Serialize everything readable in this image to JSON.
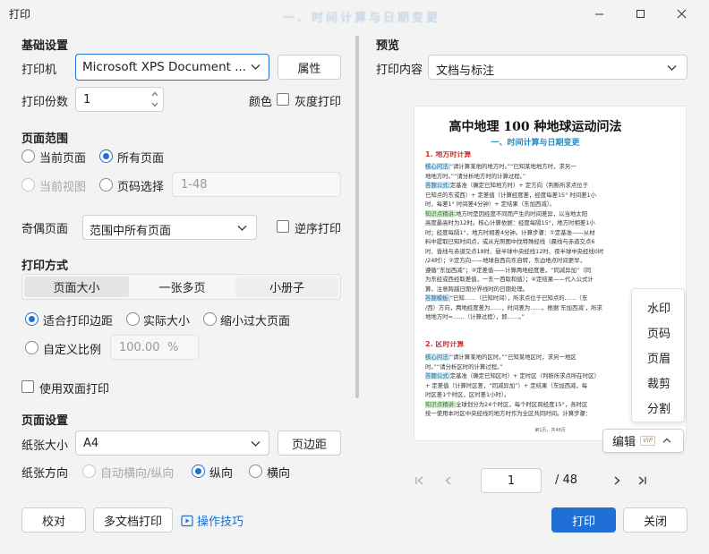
{
  "window": {
    "title": "打印",
    "faded_header": "一、时间计算与日期变更"
  },
  "basic": {
    "title": "基础设置",
    "printer_label": "打印机",
    "printer_value": "Microsoft XPS Document ...",
    "properties_button": "属性",
    "copies_label": "打印份数",
    "copies_value": "1",
    "color_label": "颜色",
    "grayscale_label": "灰度打印"
  },
  "range": {
    "title": "页面范围",
    "current_page": "当前页面",
    "all_pages": "所有页面",
    "current_view": "当前视图",
    "page_select": "页码选择",
    "page_select_placeholder": "1-48",
    "odd_even_label": "奇偶页面",
    "odd_even_value": "范围中所有页面",
    "reverse_label": "逆序打印"
  },
  "mode": {
    "title": "打印方式",
    "tabs": [
      "页面大小",
      "一张多页",
      "小册子"
    ],
    "fit_margins": "适合打印边距",
    "actual_size": "实际大小",
    "shrink_large": "缩小过大页面",
    "custom_scale": "自定义比例",
    "scale_value": "100.00",
    "scale_unit": "%",
    "duplex_label": "使用双面打印"
  },
  "page_setup": {
    "title": "页面设置",
    "paper_size_label": "纸张大小",
    "paper_size_value": "A4",
    "margins_button": "页边距",
    "orientation_label": "纸张方向",
    "auto_orientation": "自动横向/纵向",
    "portrait": "纵向",
    "landscape": "横向"
  },
  "footer": {
    "proofread_button": "校对",
    "multi_doc_button": "多文档打印",
    "tips_link": "操作技巧",
    "print_button": "打印",
    "close_button": "关闭"
  },
  "preview": {
    "title": "预览",
    "content_label": "打印内容",
    "content_value": "文档与标注",
    "edit_button": "编辑",
    "vip_badge": "VIP",
    "current_page": "1",
    "total_pages": "/ 48",
    "menu_items": [
      "水印",
      "页码",
      "页眉",
      "裁剪",
      "分割"
    ],
    "doc": {
      "title": "高中地理 100 种地球运动问法",
      "subtitle": "一、时间计算与日期变更",
      "h1": "1. 地方时计算",
      "lines": [
        {
          "tag": "核心问法:",
          "text": "“请计算某地的地方时。”“已知某地地方时，求另一"
        },
        {
          "tag": "",
          "text": "地地方时。”“请分析地方时的计算过程。”"
        },
        {
          "tag": "答题公式:",
          "text": "定基准（确定已知地方时）+ 定方向（判断所求点位于"
        },
        {
          "tag": "",
          "text": "已知点的东或西）+ 定差值（计算经度差，经度每差15° 时间差1小"
        },
        {
          "tag": "",
          "text": "时，每差1° 时间差4分钟）+ 定结果（东加西减）。"
        },
        {
          "tag": "知识点精讲:",
          "text": "地方时是因经度不同而产生的时间差异，以当地太阳"
        },
        {
          "tag": "",
          "text": "高度最高时为12时。核心计算依据：经度每隔15°，地方时相差1小"
        },
        {
          "tag": "",
          "text": "时；经度每隔1°，地方时相差4分钟。计算步骤：①定基准——从材"
        },
        {
          "tag": "",
          "text": "料中提取已知时间点，或从光照图中找特殊经线（晨线与赤道交点6"
        },
        {
          "tag": "",
          "text": "时、昏线与赤道交点18时、昼半球中央经线12时、夜半球中央经线0时"
        },
        {
          "tag": "",
          "text": "/24时）；②定方向——地球自西向东自转，东边地点时间更早，"
        },
        {
          "tag": "",
          "text": "遵循“东加西减”；③定差值——计算两地经度差，“同减异加”（同"
        },
        {
          "tag": "",
          "text": "为东经或西经取差值，一东一西取和值）；④定结果——代入公式计"
        },
        {
          "tag": "",
          "text": "算，注意跨越日期分界线时的日期处理。"
        },
        {
          "tag": "答题模板:",
          "text": "“已知……（已知时间），所求点位于已知点的……（东"
        },
        {
          "tag": "",
          "text": "/西）方向，两地经度差为……，时间差为……。根据‘东加西减’，所求"
        },
        {
          "tag": "",
          "text": "地地方时=……（计算过程），即……。”"
        }
      ],
      "h2": "2. 区时计算",
      "lines2": [
        {
          "tag": "核心问法:",
          "text": "“请计算某地的区时。”“已知某地区时，求另一地区"
        },
        {
          "tag": "",
          "text": "时。”“请分析区时的计算过程。”"
        },
        {
          "tag": "答题公式:",
          "text": "定基准（确定已知区时）+ 定时区（判断所求点所在时区）"
        },
        {
          "tag": "",
          "text": "+ 定差值（计算时区差，“同减异加”）+ 定结果（东加西减，每"
        },
        {
          "tag": "",
          "text": "时区差1个时区，区时差1小时）。"
        },
        {
          "tag": "知识点精讲:",
          "text": "全球划分为24个时区，每个时区跨经度15°，各时区"
        },
        {
          "tag": "",
          "text": "统一使用本时区中央经线的地方时作为全区共同时间。计算步骤："
        }
      ],
      "page_footer": "第1页，共48页"
    }
  },
  "colors": {
    "accent": "#1f6fd6",
    "highlight_blue": "#cfe8f4",
    "red_heading": "#d32f2f"
  },
  "icons": [
    "close-icon",
    "maximize-icon",
    "minimize-icon",
    "chevron-down-icon",
    "play-tips-icon",
    "first-page-icon",
    "prev-page-icon",
    "next-page-icon",
    "last-page-icon"
  ]
}
